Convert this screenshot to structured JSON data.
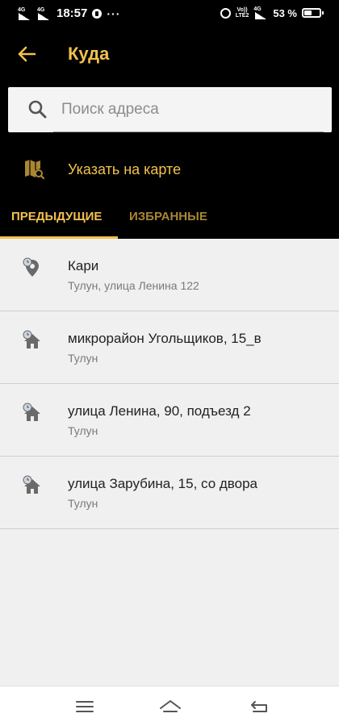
{
  "status_bar": {
    "sim1_network": "4G",
    "sim2_network": "4G",
    "time": "18:57",
    "more_indicator": "···",
    "volte_line1": "Vo))",
    "volte_line2": "LTE2",
    "data_network": "4G",
    "battery_percent": "53 %"
  },
  "header": {
    "title": "Куда",
    "back_icon": "arrow-left"
  },
  "search": {
    "placeholder": "Поиск адреса",
    "value": ""
  },
  "map_action": {
    "label": "Указать на карте",
    "icon": "map-search"
  },
  "tabs": [
    {
      "label": "ПРЕДЫДУЩИЕ",
      "active": true
    },
    {
      "label": "ИЗБРАННЫЕ",
      "active": false
    }
  ],
  "addresses": [
    {
      "name": "Кари",
      "subtitle": "Тулун, улица Ленина 122",
      "icon": "place-pin-clock-icon"
    },
    {
      "name": "микрорайон Угольщиков, 15_в",
      "subtitle": "Тулун",
      "icon": "house-clock-icon"
    },
    {
      "name": "улица Ленина, 90, подъезд 2",
      "subtitle": "Тулун",
      "icon": "house-clock-icon"
    },
    {
      "name": "улица Зарубина, 15, со двора",
      "subtitle": "Тулун",
      "icon": "house-clock-icon"
    }
  ],
  "colors": {
    "accent": "#f2c14e",
    "header_bg": "#000000",
    "list_bg": "#f0f0f0"
  }
}
